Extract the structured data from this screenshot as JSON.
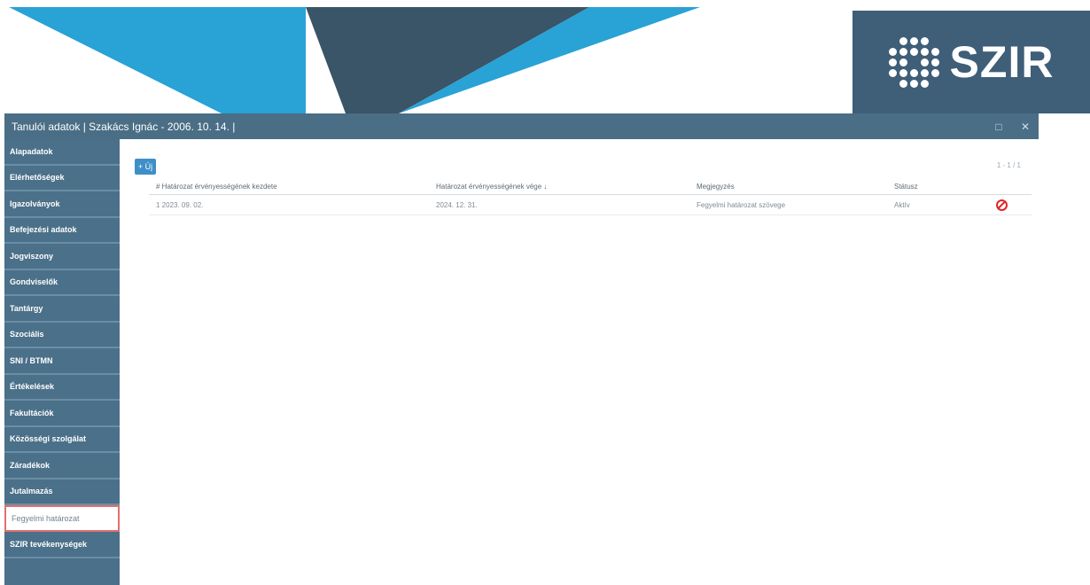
{
  "logo": {
    "text": "SZIR"
  },
  "window": {
    "title": "Tanulói adatok | Szakács Ignác - 2006. 10. 14. |",
    "maximize_label": "□",
    "close_label": "✕"
  },
  "sidebar": {
    "items": [
      {
        "label": "Alapadatok"
      },
      {
        "label": "Elérhetőségek"
      },
      {
        "label": "Igazolványok"
      },
      {
        "label": "Befejezési adatok"
      },
      {
        "label": "Jogviszony"
      },
      {
        "label": "Gondviselők"
      },
      {
        "label": "Tantárgy"
      },
      {
        "label": "Szociális"
      },
      {
        "label": "SNI / BTMN"
      },
      {
        "label": "Értékelések"
      },
      {
        "label": "Fakultációk"
      },
      {
        "label": "Közösségi szolgálat"
      },
      {
        "label": "Záradékok"
      },
      {
        "label": "Jutalmazás"
      },
      {
        "label": "Fegyelmi határozat",
        "active": true
      },
      {
        "label": "SZIR tevékenységek"
      }
    ]
  },
  "toolbar": {
    "add_label": "+ Új"
  },
  "pager": {
    "text": "1 - 1 / 1"
  },
  "table": {
    "headers": [
      "# Határozat érvényességének kezdete",
      "Határozat érvényességének vége ↓",
      "Megjegyzés",
      "Státusz"
    ],
    "rows": [
      {
        "start": "1 2023. 09. 02.",
        "end": "2024. 12. 31.",
        "note": "Fegyelmi határozat szövege",
        "status": "Aktív"
      }
    ]
  },
  "colors": {
    "sidebar": "#4b7089",
    "titlebar": "#4a6e85",
    "accent": "#3e8fc8",
    "delete": "#e0252b"
  }
}
